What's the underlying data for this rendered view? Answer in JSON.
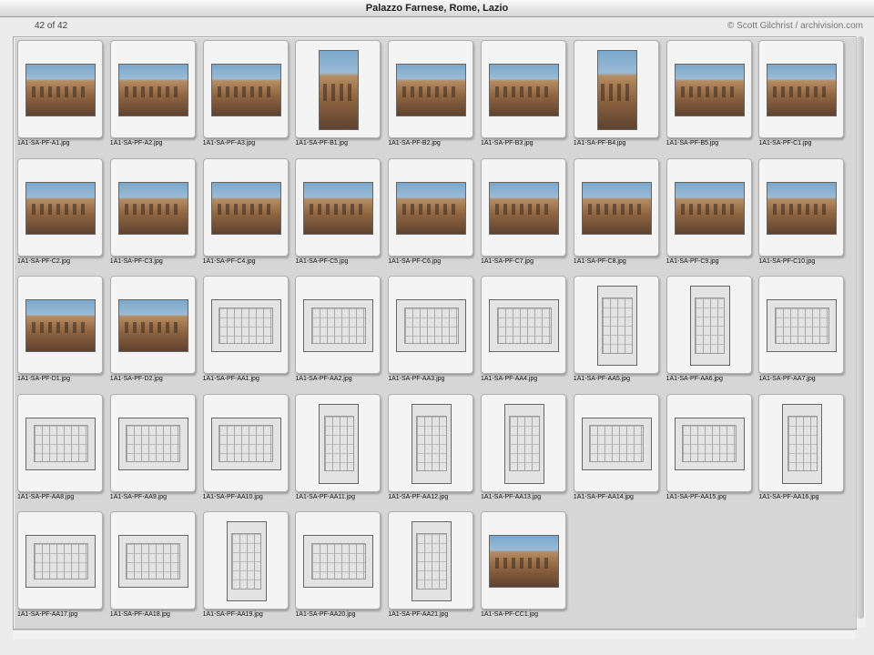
{
  "window": {
    "title": "Palazzo Farnese, Rome, Lazio"
  },
  "info": {
    "count": "42 of 42",
    "credit": "© Scott Gilchrist / archivision.com"
  },
  "thumbnails": [
    "1A1-SA-PF-A1.jpg",
    "1A1-SA-PF-A2.jpg",
    "1A1-SA-PF-A3.jpg",
    "1A1-SA-PF-B1.jpg",
    "1A1-SA-PF-B2.jpg",
    "1A1-SA-PF-B3.jpg",
    "1A1-SA-PF-B4.jpg",
    "1A1-SA-PF-B5.jpg",
    "1A1-SA-PF-C1.jpg",
    "1A1-SA-PF-C2.jpg",
    "1A1-SA-PF-C3.jpg",
    "1A1-SA-PF-C4.jpg",
    "1A1-SA-PF-C5.jpg",
    "1A1-SA-PF-C6.jpg",
    "1A1-SA-PF-C7.jpg",
    "1A1-SA-PF-C8.jpg",
    "1A1-SA-PF-C9.jpg",
    "1A1-SA-PF-C10.jpg",
    "1A1-SA-PF-D1.jpg",
    "1A1-SA-PF-D2.jpg",
    "1A1-SA-PF-AA1.jpg",
    "1A1-SA-PF-AA2.jpg",
    "1A1-SA-PF-AA3.jpg",
    "1A1-SA-PF-AA4.jpg",
    "1A1-SA-PF-AA5.jpg",
    "1A1-SA-PF-AA6.jpg",
    "1A1-SA-PF-AA7.jpg",
    "1A1-SA-PF-AA8.jpg",
    "1A1-SA-PF-AA9.jpg",
    "1A1-SA-PF-AA10.jpg",
    "1A1-SA-PF-AA11.jpg",
    "1A1-SA-PF-AA12.jpg",
    "1A1-SA-PF-AA13.jpg",
    "1A1-SA-PF-AA14.jpg",
    "1A1-SA-PF-AA15.jpg",
    "1A1-SA-PF-AA16.jpg",
    "1A1-SA-PF-AA17.jpg",
    "1A1-SA-PF-AA18.jpg",
    "1A1-SA-PF-AA19.jpg",
    "1A1-SA-PF-AA20.jpg",
    "1A1-SA-PF-AA21.jpg",
    "1A1-SA-PF-CC1.jpg"
  ]
}
